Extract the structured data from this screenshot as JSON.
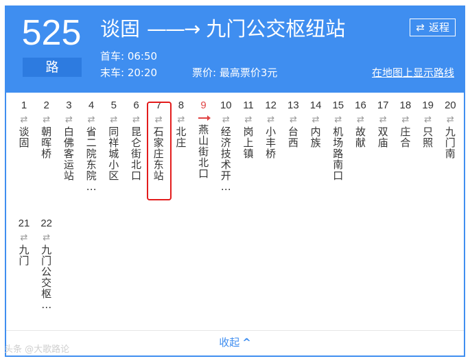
{
  "header": {
    "route_number": "525",
    "route_suffix": "路",
    "origin": "谈固",
    "arrow": "——→",
    "destination": "九门公交枢纽站",
    "first_bus_label": "首车:",
    "first_bus_time": "06:50",
    "last_bus_label": "末车:",
    "last_bus_time": "20:20",
    "price_label": "票价:",
    "price_value": "最高票价3元",
    "return_label": "返程",
    "map_link": "在地图上显示路线"
  },
  "stops": [
    {
      "num": "1",
      "name": "谈固"
    },
    {
      "num": "2",
      "name": "朝晖桥"
    },
    {
      "num": "3",
      "name": "白佛客运站"
    },
    {
      "num": "4",
      "name": "省二院东院…"
    },
    {
      "num": "5",
      "name": "同祥城小区"
    },
    {
      "num": "6",
      "name": "昆仑街北口"
    },
    {
      "num": "7",
      "name": "石家庄东站"
    },
    {
      "num": "8",
      "name": "北庄"
    },
    {
      "num": "9",
      "name": "燕山街北口"
    },
    {
      "num": "10",
      "name": "经济技术开…"
    },
    {
      "num": "11",
      "name": "岗上镇"
    },
    {
      "num": "12",
      "name": "小丰桥"
    },
    {
      "num": "13",
      "name": "台西"
    },
    {
      "num": "14",
      "name": "内族"
    },
    {
      "num": "15",
      "name": "机场路南口"
    },
    {
      "num": "16",
      "name": "故献"
    },
    {
      "num": "17",
      "name": "双庙"
    },
    {
      "num": "18",
      "name": "庄合"
    },
    {
      "num": "19",
      "name": "只照"
    },
    {
      "num": "20",
      "name": "九门南"
    },
    {
      "num": "21",
      "name": "九门"
    },
    {
      "num": "22",
      "name": "九门公交枢…"
    }
  ],
  "highlighted_stop": "7",
  "current_bus_stop": "9",
  "collapse_label": "收起",
  "watermark": "头条 @大歌路论",
  "colors": {
    "header_bg": "#3f8ef0",
    "highlight": "#e31b1b",
    "link": "#3f8ef0",
    "bus": "#e04343"
  }
}
